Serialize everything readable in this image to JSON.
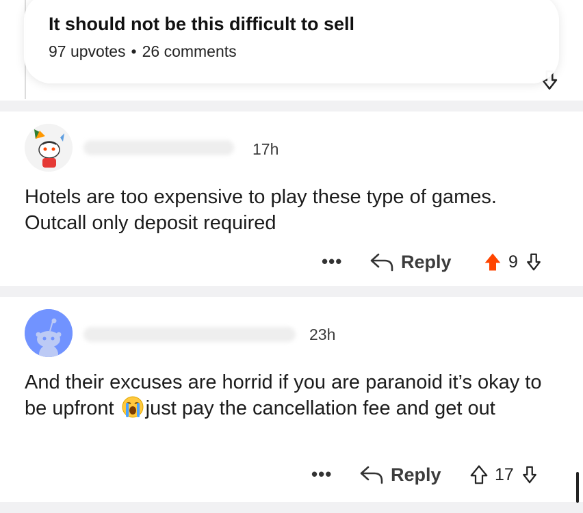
{
  "post": {
    "title": "It should not be this difficult to sell",
    "upvotes": "97 upvotes",
    "separator": "•",
    "comments": "26 comments"
  },
  "comments": [
    {
      "timestamp": "17h",
      "body": "Hotels are too expensive to play these type of games. Outcall only deposit required",
      "more": "•••",
      "reply_label": "Reply",
      "score": "9",
      "upvoted": true
    },
    {
      "timestamp": "23h",
      "body_before_emoji": "And their excuses are horrid if you are paranoid it’s okay to be upfront",
      "body_after_emoji": "just pay the cancellation fee and get out",
      "more": "•••",
      "reply_label": "Reply",
      "score": "17",
      "upvoted": false
    }
  ],
  "colors": {
    "upvote_active": "#ff4500",
    "avatar_blue": "#7193ff",
    "separator": "#f1f1f3"
  },
  "icons": {
    "reply": "reply-arrow-icon",
    "upvote": "upvote-arrow-icon",
    "downvote": "downvote-arrow-icon",
    "more": "more-dots-icon",
    "emoji": "loudly-crying-face-icon"
  }
}
